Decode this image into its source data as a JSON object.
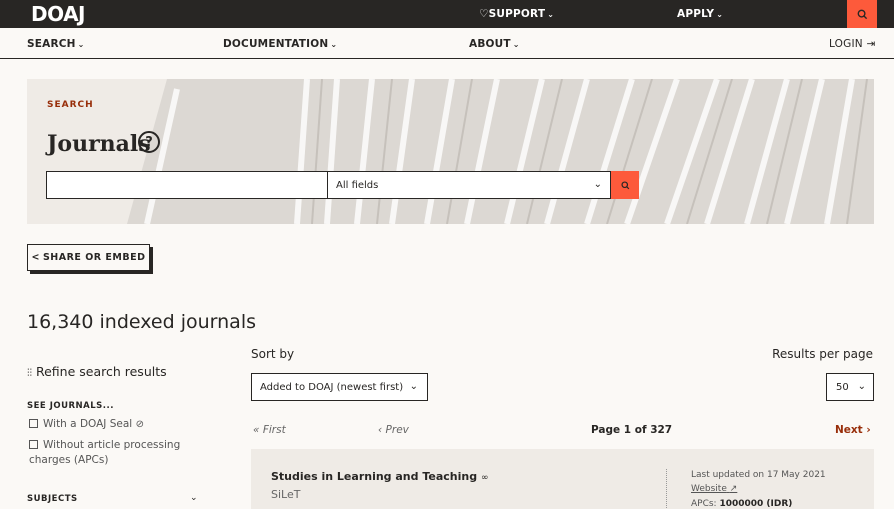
{
  "topbar": {
    "logo": "DOAJ",
    "support_label": "SUPPORT",
    "apply_label": "APPLY",
    "search_icon": "search-icon"
  },
  "subnav": {
    "search": "SEARCH",
    "documentation": "DOCUMENTATION",
    "about": "ABOUT",
    "login": "LOGIN"
  },
  "hero": {
    "label": "SEARCH",
    "title": "Journals",
    "help_glyph": "?",
    "search_value": "",
    "field_select": "All fields"
  },
  "share_label": "SHARE OR EMBED",
  "count": "16,340 indexed journals",
  "facets": {
    "refine_label": "Refine search results",
    "see_journals_head": "SEE JOURNALS...",
    "options": [
      "With a DOAJ Seal",
      "Without article processing charges (APCs)"
    ],
    "subjects_head": "SUBJECTS"
  },
  "results": {
    "sort_label": "Sort by",
    "sort_value": "Added to DOAJ (newest first)",
    "rpp_label": "Results per page",
    "rpp_value": "50",
    "first": "First",
    "prev": "Prev",
    "page": "Page 1 of 327",
    "next": "Next"
  },
  "card": {
    "title": "Studies in Learning and Teaching",
    "abbr": "SiLeT",
    "updated": "Last updated on 17 May 2021",
    "website": "Website",
    "apc_label": "APCs: ",
    "apc_value": "1000000 (IDR)"
  },
  "colors": {
    "dark": "#282624",
    "accent": "#fd5a3b",
    "brick": "#982e0a",
    "background": "#fbf9f6"
  }
}
